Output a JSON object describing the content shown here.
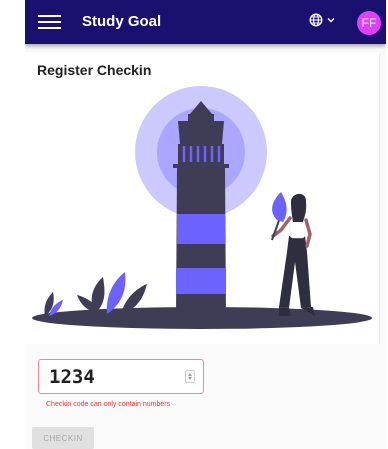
{
  "appbar": {
    "title": "Study Goal",
    "avatar_initials": "FF",
    "menu_icon": "hamburger-icon",
    "language_icon": "globe-icon",
    "background": "#1a1070"
  },
  "card": {
    "title": "Register Checkin",
    "illustration": "lighthouse-with-woman-holding-torch"
  },
  "form": {
    "code_value": "1234",
    "error_text": "Checkin code can only contain numbers",
    "submit_label": "CHECKIN"
  },
  "colors": {
    "accent": "#6c63ff",
    "avatar": "#e040fb",
    "error": "#e53935"
  }
}
